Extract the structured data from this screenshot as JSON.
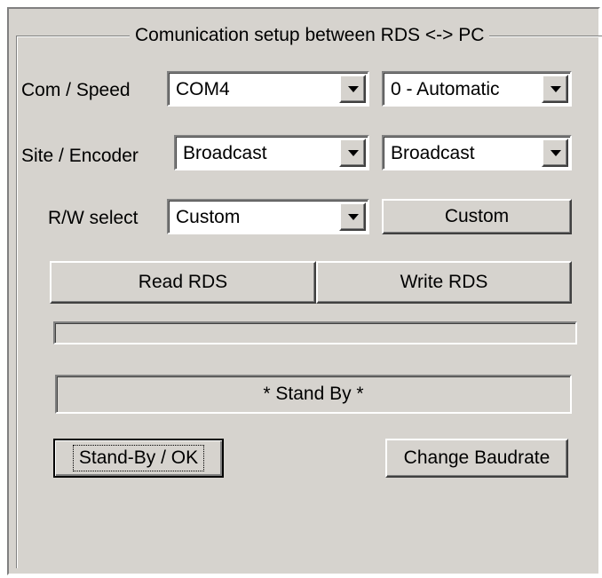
{
  "group": {
    "title": "Comunication setup between RDS <-> PC"
  },
  "com_speed": {
    "label": "Com / Speed",
    "port": "COM4",
    "speed": "0 - Automatic"
  },
  "site_encoder": {
    "label": "Site / Encoder",
    "site": "Broadcast",
    "encoder": "Broadcast"
  },
  "rw_select": {
    "label": "R/W select",
    "value": "Custom",
    "button": "Custom"
  },
  "actions": {
    "read": "Read RDS",
    "write": "Write RDS"
  },
  "progress": {
    "value": 0
  },
  "status": {
    "text": "* Stand By *"
  },
  "footer": {
    "standby_ok": "Stand-By / OK",
    "change_baud": "Change Baudrate"
  }
}
